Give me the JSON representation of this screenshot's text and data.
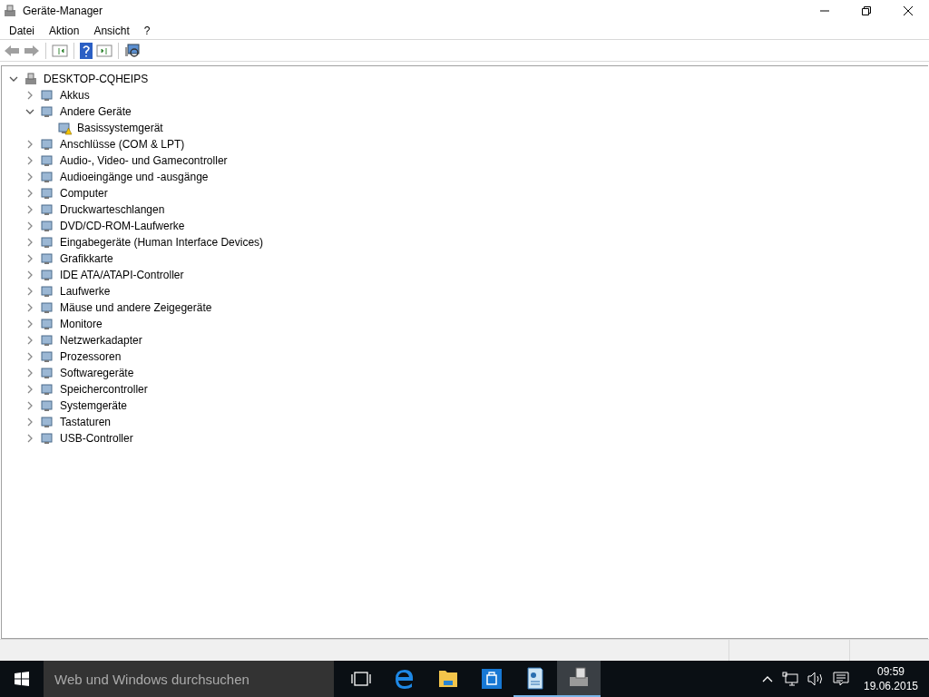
{
  "window": {
    "title": "Geräte-Manager"
  },
  "menu": [
    "Datei",
    "Aktion",
    "Ansicht",
    "?"
  ],
  "tree": {
    "label": "DESKTOP-CQHEIPS",
    "expanded": true,
    "children": [
      {
        "label": "Akkus",
        "expanded": false,
        "warning": false
      },
      {
        "label": "Andere Geräte",
        "expanded": true,
        "warning": false,
        "children": [
          {
            "label": "Basissystemgerät",
            "warning": true
          }
        ]
      },
      {
        "label": "Anschlüsse (COM & LPT)",
        "expanded": false,
        "warning": false
      },
      {
        "label": "Audio-, Video- und Gamecontroller",
        "expanded": false,
        "warning": false
      },
      {
        "label": "Audioeingänge und -ausgänge",
        "expanded": false,
        "warning": false
      },
      {
        "label": "Computer",
        "expanded": false,
        "warning": false
      },
      {
        "label": "Druckwarteschlangen",
        "expanded": false,
        "warning": false
      },
      {
        "label": "DVD/CD-ROM-Laufwerke",
        "expanded": false,
        "warning": false
      },
      {
        "label": "Eingabegeräte (Human Interface Devices)",
        "expanded": false,
        "warning": false
      },
      {
        "label": "Grafikkarte",
        "expanded": false,
        "warning": false
      },
      {
        "label": "IDE ATA/ATAPI-Controller",
        "expanded": false,
        "warning": false
      },
      {
        "label": "Laufwerke",
        "expanded": false,
        "warning": false
      },
      {
        "label": "Mäuse und andere Zeigegeräte",
        "expanded": false,
        "warning": false
      },
      {
        "label": "Monitore",
        "expanded": false,
        "warning": false
      },
      {
        "label": "Netzwerkadapter",
        "expanded": false,
        "warning": false
      },
      {
        "label": "Prozessoren",
        "expanded": false,
        "warning": false
      },
      {
        "label": "Softwaregeräte",
        "expanded": false,
        "warning": false
      },
      {
        "label": "Speichercontroller",
        "expanded": false,
        "warning": false
      },
      {
        "label": "Systemgeräte",
        "expanded": false,
        "warning": false
      },
      {
        "label": "Tastaturen",
        "expanded": false,
        "warning": false
      },
      {
        "label": "USB-Controller",
        "expanded": false,
        "warning": false
      }
    ]
  },
  "taskbar": {
    "search": {
      "placeholder": "Web und Windows durchsuchen"
    },
    "time": "09:59",
    "date": "19.06.2015"
  }
}
